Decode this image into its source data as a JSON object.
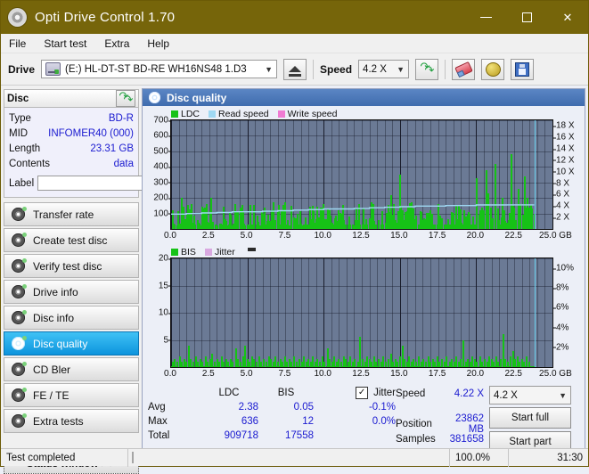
{
  "window": {
    "title": "Opti Drive Control 1.70",
    "icon": "disc-icon",
    "controls": {
      "minimize": "–",
      "maximize": "□",
      "close": "✕"
    }
  },
  "menu": [
    {
      "label": "File"
    },
    {
      "label": "Start test"
    },
    {
      "label": "Extra"
    },
    {
      "label": "Help"
    }
  ],
  "toolbar": {
    "drive_label": "Drive",
    "drive_value": "(E:)  HL-DT-ST BD-RE  WH16NS48 1.D3",
    "eject_icon": "eject-icon",
    "speed_label": "Speed",
    "speed_value": "4.2 X",
    "refresh_icon": "refresh-icon",
    "erase_icon": "eraser-icon",
    "disc_icon": "gold-disc-icon",
    "save_icon": "floppy-save-icon"
  },
  "disc": {
    "header": "Disc",
    "refresh_icon": "refresh-icon",
    "rows": [
      {
        "key": "Type",
        "value": "BD-R"
      },
      {
        "key": "MID",
        "value": "INFOMER40 (000)"
      },
      {
        "key": "Length",
        "value": "23.31 GB"
      },
      {
        "key": "Contents",
        "value": "data"
      }
    ],
    "label_key": "Label",
    "label_value": "",
    "label_placeholder": "",
    "label_button_icon": "cd-icon"
  },
  "nav": {
    "items": [
      {
        "label": "Transfer rate",
        "active": false
      },
      {
        "label": "Create test disc",
        "active": false
      },
      {
        "label": "Verify test disc",
        "active": false
      },
      {
        "label": "Drive info",
        "active": false
      },
      {
        "label": "Disc info",
        "active": false
      },
      {
        "label": "Disc quality",
        "active": true
      },
      {
        "label": "CD Bler",
        "active": false
      },
      {
        "label": "FE / TE",
        "active": false
      },
      {
        "label": "Extra tests",
        "active": false
      }
    ],
    "status_window": "Status window > >"
  },
  "panel": {
    "title": "Disc quality",
    "icon": "disc-quality-icon"
  },
  "chart_data": [
    {
      "type": "bar",
      "id": "ldc-chart",
      "title": "",
      "xlabel": "GB",
      "ylabel": "",
      "xlim": [
        0,
        25
      ],
      "ylim": [
        0,
        700
      ],
      "y2lim": [
        0,
        19
      ],
      "grid": true,
      "legend": [
        {
          "label": "LDC",
          "color": "#16c216"
        },
        {
          "label": "Read speed",
          "color": "#9fd8f2"
        },
        {
          "label": "Write speed",
          "color": "#f07ad2"
        }
      ],
      "xticks": [
        "0.0",
        "2.5",
        "5.0",
        "7.5",
        "10.0",
        "12.5",
        "15.0",
        "17.5",
        "20.0",
        "22.5",
        "25.0"
      ],
      "yticks": [
        "700",
        "600",
        "500",
        "400",
        "300",
        "200",
        "100"
      ],
      "y2ticks": [
        "18 X",
        "16 X",
        "14 X",
        "12 X",
        "10 X",
        "8 X",
        "6 X",
        "4 X",
        "2 X"
      ],
      "x_unit_label": "GB",
      "cursor_x": 23.86,
      "series": [
        {
          "name": "LDC",
          "color": "#16c216",
          "x": [
            0.05,
            0.2,
            0.35,
            0.5,
            0.62,
            0.75,
            0.9,
            1.05,
            1.2,
            1.35,
            1.5,
            1.68,
            1.8,
            1.95,
            2.1,
            2.25,
            2.4,
            2.55,
            2.7,
            2.85,
            3.0,
            3.15,
            3.3,
            3.45,
            3.6,
            3.75,
            3.9,
            4.05,
            4.2,
            4.35,
            4.5,
            4.65,
            4.8,
            4.95,
            5.1,
            5.25,
            5.4,
            5.55,
            5.7,
            5.85,
            6.0,
            6.2,
            6.35,
            6.5,
            6.65,
            6.8,
            6.95,
            7.1,
            7.25,
            7.4,
            7.55,
            7.7,
            7.85,
            8.0,
            8.2,
            8.35,
            8.5,
            8.65,
            8.8,
            8.95,
            9.1,
            9.25,
            9.4,
            9.55,
            9.7,
            9.85,
            10.0,
            10.2,
            10.35,
            10.5,
            10.65,
            10.8,
            10.95,
            11.1,
            11.25,
            11.4,
            11.55,
            11.7,
            11.85,
            12.0,
            12.2,
            12.35,
            12.5,
            12.65,
            12.8,
            12.95,
            13.1,
            13.25,
            13.4,
            13.55,
            13.7,
            13.85,
            14.0,
            14.2,
            14.35,
            14.5,
            14.65,
            14.8,
            14.95,
            15.1,
            15.25,
            15.4,
            15.55,
            15.7,
            15.85,
            16.0,
            16.2,
            16.35,
            16.5,
            16.65,
            16.8,
            16.95,
            17.1,
            17.25,
            17.4,
            17.55,
            17.7,
            17.85,
            18.0,
            18.2,
            18.35,
            18.5,
            18.65,
            18.8,
            18.95,
            19.1,
            19.25,
            19.4,
            19.55,
            19.7,
            19.85,
            20.0,
            20.15,
            20.3,
            20.45,
            20.6,
            20.75,
            20.9,
            21.05,
            21.2,
            21.35,
            21.5,
            21.65,
            21.8,
            21.95,
            22.1,
            22.25,
            22.4,
            22.55,
            22.7,
            22.85,
            23.0,
            23.15,
            23.3,
            23.45,
            23.6,
            23.75
          ],
          "values": [
            40,
            30,
            25,
            35,
            200,
            60,
            28,
            30,
            25,
            40,
            30,
            60,
            35,
            25,
            130,
            30,
            25,
            200,
            45,
            30,
            25,
            35,
            30,
            26,
            24,
            30,
            25,
            35,
            28,
            26,
            30,
            40,
            25,
            30,
            24,
            28,
            26,
            30,
            25,
            24,
            28,
            26,
            30,
            25,
            170,
            60,
            30,
            26,
            28,
            170,
            30,
            25,
            26,
            40,
            30,
            26,
            24,
            30,
            28,
            26,
            30,
            150,
            40,
            26,
            28,
            30,
            25,
            60,
            120,
            40,
            30,
            26,
            28,
            30,
            25,
            26,
            28,
            30,
            26,
            25,
            60,
            30,
            26,
            30,
            28,
            26,
            170,
            50,
            30,
            26,
            28,
            30,
            25,
            30,
            220,
            90,
            60,
            40,
            350,
            120,
            60,
            30,
            28,
            170,
            40,
            30,
            26,
            28,
            60,
            30,
            26,
            30,
            28,
            26,
            30,
            40,
            28,
            26,
            30,
            26,
            28,
            30,
            26,
            28,
            30,
            26,
            28,
            60,
            30,
            26,
            30,
            330,
            90,
            60,
            120,
            380,
            230,
            140,
            70,
            420,
            60,
            30,
            200,
            120,
            40,
            60,
            480,
            100,
            60,
            260,
            160,
            90,
            340,
            200,
            120,
            60,
            100
          ]
        },
        {
          "name": "Read speed",
          "color": "#9fd8f2",
          "x": [
            0.0,
            1.0,
            2.0,
            3.0,
            4.0,
            5.0,
            6.0,
            7.0,
            8.0,
            9.0,
            10.0,
            11.0,
            12.0,
            13.0,
            14.0,
            15.0,
            16.0,
            17.0,
            18.0,
            19.0,
            20.0,
            21.0,
            22.0,
            23.0,
            23.8
          ],
          "values": [
            2.6,
            2.7,
            2.8,
            2.9,
            3.0,
            3.0,
            3.1,
            3.2,
            3.3,
            3.4,
            3.5,
            3.5,
            3.6,
            3.7,
            3.8,
            3.9,
            4.0,
            4.0,
            4.1,
            4.1,
            4.2,
            4.2,
            4.22,
            4.22,
            4.22
          ],
          "unit": "X"
        }
      ]
    },
    {
      "type": "bar",
      "id": "bis-chart",
      "title": "",
      "xlabel": "GB",
      "xlim": [
        0,
        25
      ],
      "ylim": [
        0,
        20
      ],
      "y2lim": [
        0,
        11
      ],
      "grid": true,
      "legend": [
        {
          "label": "BIS",
          "color": "#16c216"
        },
        {
          "label": "Jitter",
          "color": "#d9a8e0"
        }
      ],
      "xticks": [
        "0.0",
        "2.5",
        "5.0",
        "7.5",
        "10.0",
        "12.5",
        "15.0",
        "17.5",
        "20.0",
        "22.5",
        "25.0"
      ],
      "yticks": [
        "20",
        "15",
        "10",
        "5"
      ],
      "y2ticks": [
        "10%",
        "8%",
        "6%",
        "4%",
        "2%"
      ],
      "x_unit_label": "GB",
      "cursor_x": 23.86,
      "series": [
        {
          "name": "BIS",
          "color": "#16c216",
          "x": [
            0.05,
            0.2,
            0.35,
            0.5,
            0.65,
            0.8,
            0.95,
            1.1,
            1.25,
            1.4,
            1.55,
            1.7,
            1.85,
            2.0,
            2.2,
            2.35,
            2.5,
            2.65,
            2.8,
            2.95,
            3.1,
            3.25,
            3.4,
            3.55,
            3.7,
            3.85,
            4.0,
            4.2,
            4.35,
            4.5,
            4.65,
            4.8,
            4.95,
            5.1,
            5.25,
            5.4,
            5.55,
            5.7,
            5.85,
            6.0,
            6.2,
            6.35,
            6.5,
            6.65,
            6.8,
            6.95,
            7.1,
            7.25,
            7.4,
            7.55,
            7.7,
            7.85,
            8.0,
            8.2,
            8.35,
            8.5,
            8.65,
            8.8,
            8.95,
            9.1,
            9.25,
            9.4,
            9.55,
            9.7,
            9.85,
            10.0,
            10.2,
            10.35,
            10.5,
            10.65,
            10.8,
            10.95,
            11.1,
            11.25,
            11.4,
            11.55,
            11.7,
            11.85,
            12.0,
            12.2,
            12.35,
            12.5,
            12.65,
            12.8,
            12.95,
            13.1,
            13.25,
            13.4,
            13.55,
            13.7,
            13.85,
            14.0,
            14.2,
            14.35,
            14.5,
            14.65,
            14.8,
            14.95,
            15.1,
            15.25,
            15.4,
            15.55,
            15.7,
            15.85,
            16.0,
            16.2,
            16.35,
            16.5,
            16.65,
            16.8,
            16.95,
            17.1,
            17.25,
            17.4,
            17.55,
            17.7,
            17.85,
            18.0,
            18.2,
            18.35,
            18.5,
            18.65,
            18.8,
            18.95,
            19.1,
            19.25,
            19.4,
            19.55,
            19.7,
            19.85,
            20.0,
            20.2,
            20.35,
            20.5,
            20.65,
            20.8,
            20.95,
            21.1,
            21.25,
            21.4,
            21.55,
            21.7,
            21.85,
            22.0,
            22.2,
            22.35,
            22.5,
            22.65,
            22.8,
            22.95,
            23.1,
            23.25,
            23.4,
            23.55,
            23.7
          ],
          "values": [
            1,
            1.5,
            1,
            2,
            1,
            1.5,
            1,
            4,
            1.5,
            1,
            2,
            1,
            1.5,
            1,
            2,
            1,
            1.5,
            2.5,
            1,
            1.5,
            1,
            2,
            1,
            1.5,
            1,
            1.5,
            1,
            3.5,
            1.5,
            1,
            2,
            4,
            1.5,
            1,
            2,
            1.5,
            1,
            2,
            1,
            1.5,
            1,
            2,
            1.5,
            1,
            2,
            1,
            1.5,
            1,
            2,
            1,
            1.5,
            1,
            2,
            1,
            1.5,
            1,
            2,
            1,
            1.5,
            1,
            2,
            1,
            1.5,
            1,
            2,
            1,
            3.5,
            1.5,
            1,
            2,
            1,
            1.5,
            1,
            2,
            1.5,
            1,
            2,
            1,
            1.5,
            1,
            5.5,
            1.5,
            1,
            2,
            1.5,
            1,
            2,
            1,
            1.5,
            1,
            2,
            1,
            1.5,
            2.5,
            1,
            1.5,
            1,
            2,
            4,
            1.5,
            1,
            2,
            1,
            1.5,
            1,
            2,
            1,
            1.5,
            1,
            2,
            1,
            1.5,
            1,
            2,
            1,
            1.5,
            1,
            2,
            1,
            1.5,
            1,
            2,
            1,
            1.5,
            5,
            1,
            1.5,
            1,
            2,
            1.5,
            1,
            2,
            1,
            1.5,
            1,
            2,
            1.5,
            1,
            2,
            1,
            1.5,
            6,
            1.5,
            1,
            2,
            3,
            1.5,
            2,
            1,
            1.5,
            1,
            2,
            1
          ]
        }
      ]
    }
  ],
  "stats": {
    "headers": [
      "",
      "LDC",
      "BIS",
      "Jitter"
    ],
    "jitter_checkbox": {
      "label": "Jitter",
      "checked": true,
      "mark": "✓"
    },
    "rows": [
      {
        "label": "Avg",
        "ldc": "2.38",
        "bis": "0.05",
        "jitter": "-0.1%"
      },
      {
        "label": "Max",
        "ldc": "636",
        "bis": "12",
        "jitter": "0.0%"
      },
      {
        "label": "Total",
        "ldc": "909718",
        "bis": "17558",
        "jitter": ""
      }
    ]
  },
  "readout": {
    "speed_key": "Speed",
    "speed_value": "4.22 X",
    "speed_select": "4.2 X",
    "position_key": "Position",
    "position_value": "23862 MB",
    "samples_key": "Samples",
    "samples_value": "381658",
    "start_full": "Start full",
    "start_part": "Start part"
  },
  "statusbar": {
    "text": "Test completed",
    "percent_label": "100.0%",
    "percent_value": 100,
    "time": "31:30"
  }
}
